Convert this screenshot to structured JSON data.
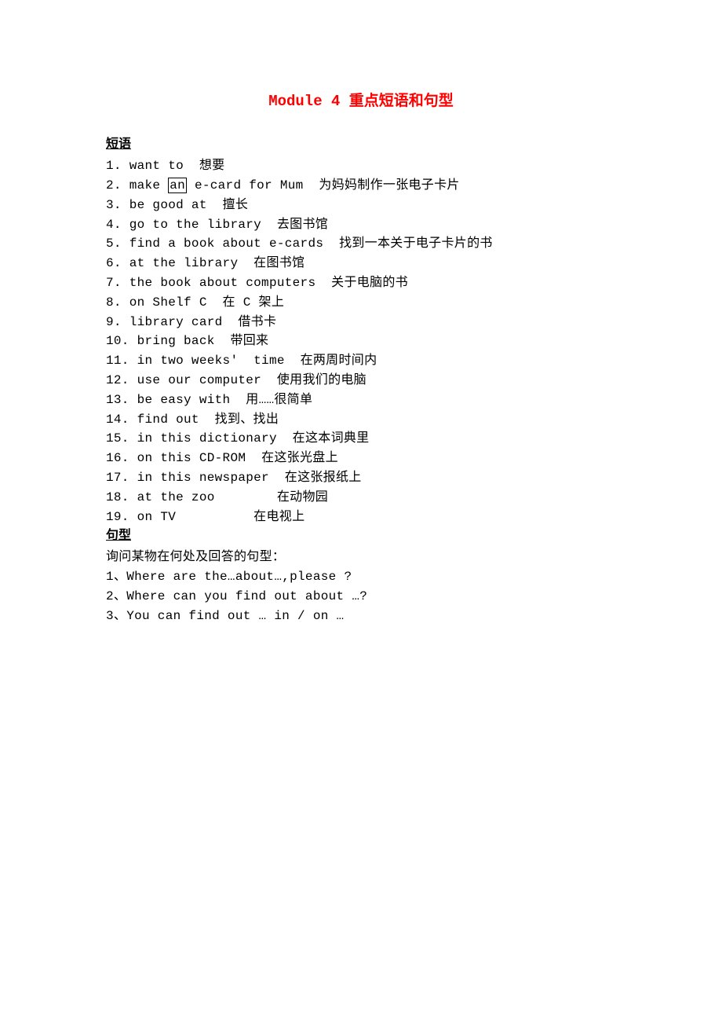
{
  "title": "Module 4 重点短语和句型",
  "sections": {
    "phrases": {
      "header": "短语",
      "items": [
        {
          "num": "1.",
          "en": "want to",
          "zh": "想要",
          "boxed": null
        },
        {
          "num": "2.",
          "en_pre": "make ",
          "boxed": "an",
          "en_post": " e-card for Mum",
          "zh": "为妈妈制作一张电子卡片"
        },
        {
          "num": "3.",
          "en": "be good at",
          "zh": "擅长",
          "boxed": null
        },
        {
          "num": "4.",
          "en": "go to the library",
          "zh": "去图书馆",
          "boxed": null
        },
        {
          "num": "5.",
          "en": "find a book about e-cards",
          "zh": "找到一本关于电子卡片的书",
          "boxed": null
        },
        {
          "num": "6.",
          "en": "at the library",
          "zh": "在图书馆",
          "boxed": null
        },
        {
          "num": "7.",
          "en": "the book about computers",
          "zh": "关于电脑的书",
          "boxed": null
        },
        {
          "num": "8.",
          "en": "on Shelf C",
          "zh": "在 C 架上",
          "boxed": null
        },
        {
          "num": "9.",
          "en": "library card",
          "zh": "借书卡",
          "boxed": null
        },
        {
          "num": "10.",
          "en": "bring back",
          "zh": "带回来",
          "boxed": null
        },
        {
          "num": "11.",
          "en": "in two weeks'  time",
          "zh": "在两周时间内",
          "boxed": null
        },
        {
          "num": "12.",
          "en": "use our computer",
          "zh": "使用我们的电脑",
          "boxed": null
        },
        {
          "num": "13.",
          "en": "be easy with",
          "zh": "用……很简单",
          "boxed": null
        },
        {
          "num": "14.",
          "en": "find out",
          "zh": "找到、找出",
          "boxed": null
        },
        {
          "num": "15.",
          "en": "in this dictionary",
          "zh": "在这本词典里",
          "boxed": null
        },
        {
          "num": "16.",
          "en": "on this CD-ROM",
          "zh": "在这张光盘上",
          "boxed": null
        },
        {
          "num": "17.",
          "en": "in this newspaper",
          "zh": "在这张报纸上",
          "boxed": null
        },
        {
          "num": "18.",
          "en": "at the zoo      ",
          "zh": "在动物园",
          "boxed": null
        },
        {
          "num": "19.",
          "en": "on TV        ",
          "zh": "在电视上",
          "boxed": null
        }
      ]
    },
    "sentences": {
      "header": "句型",
      "intro": "询问某物在何处及回答的句型：",
      "items": [
        "1、Where are the…about…,please ?",
        "2、Where can you find out about …?",
        "3、You can find out … in / on …"
      ]
    }
  }
}
